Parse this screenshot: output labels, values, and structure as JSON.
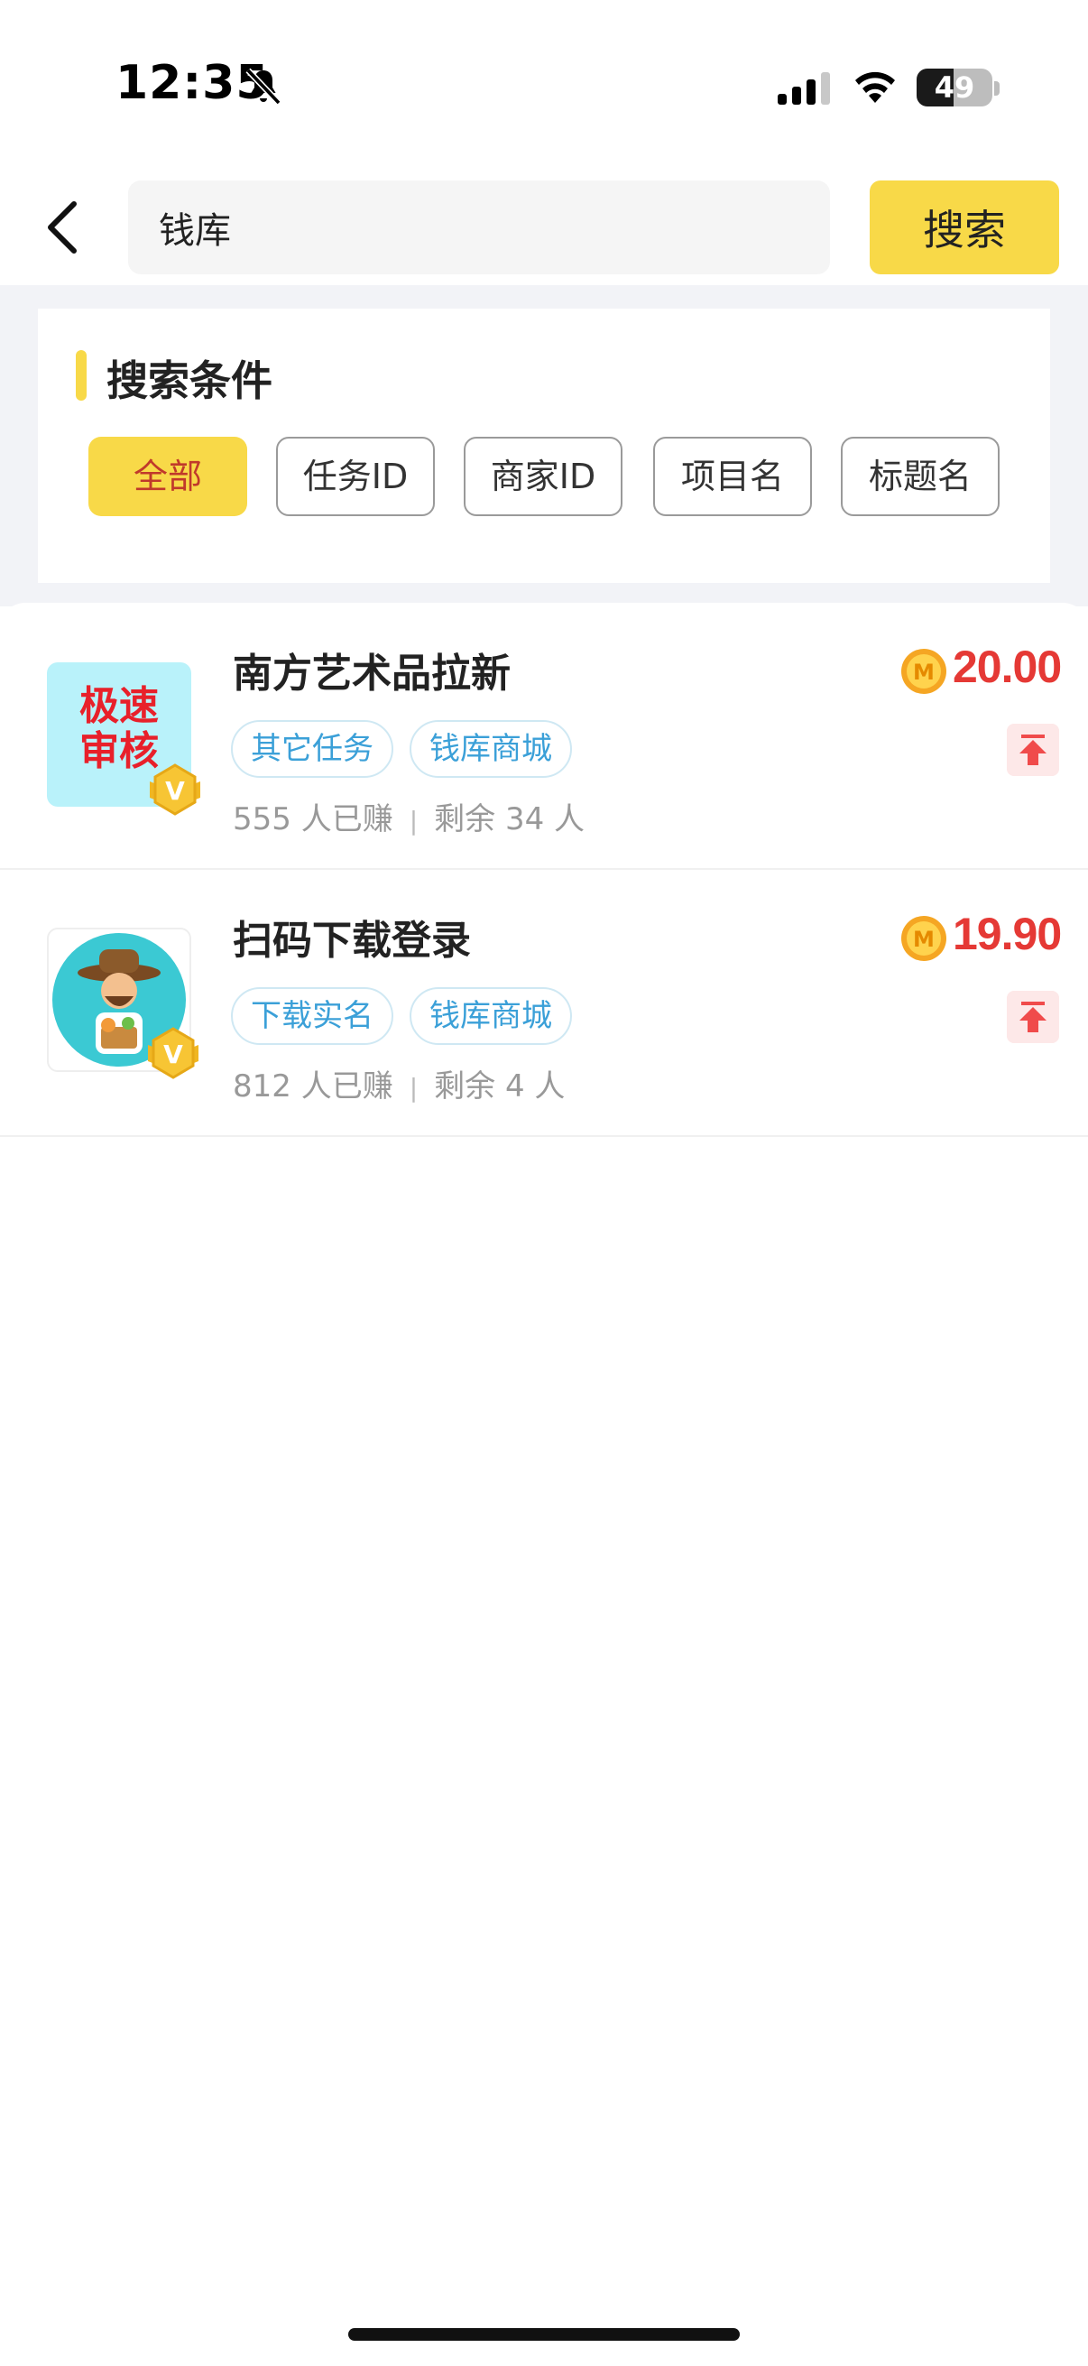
{
  "status_bar": {
    "time": "12:35",
    "battery": "49",
    "battery_level": 0.49
  },
  "search": {
    "value": "钱库",
    "placeholder": "",
    "button_label": "搜索"
  },
  "criteria": {
    "title": "搜索条件",
    "filters": [
      {
        "label": "全部",
        "active": true
      },
      {
        "label": "任务ID",
        "active": false
      },
      {
        "label": "商家ID",
        "active": false
      },
      {
        "label": "项目名",
        "active": false
      },
      {
        "label": "标题名",
        "active": false
      }
    ]
  },
  "tasks": [
    {
      "title": "南方艺术品拉新",
      "thumb_text": "极速审核",
      "tags": [
        "其它任务",
        "钱库商城"
      ],
      "earned": "555 人已赚",
      "remaining": "剩余 34 人",
      "price": "20.00"
    },
    {
      "title": "扫码下载登录",
      "thumb_text": "",
      "tags": [
        "下载实名",
        "钱库商城"
      ],
      "earned": "812 人已赚",
      "remaining": "剩余 4 人",
      "price": "19.90"
    }
  ],
  "colors": {
    "accent": "#f8d948",
    "price": "#e53935",
    "tag": "#3ba0d8"
  },
  "icons": [
    "bell-slash-icon",
    "signal-icon",
    "wifi-icon",
    "battery-icon",
    "back-arrow-icon",
    "coin-icon",
    "pin-top-icon",
    "verified-badge-icon"
  ]
}
